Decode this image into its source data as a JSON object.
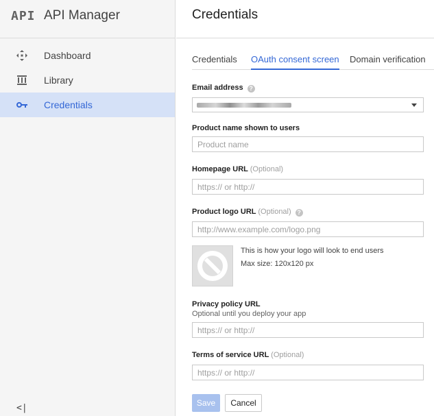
{
  "app": {
    "logo": "API",
    "title": "API Manager"
  },
  "sidebar": {
    "items": [
      {
        "label": "Dashboard",
        "icon": "dashboard-icon",
        "active": false
      },
      {
        "label": "Library",
        "icon": "library-icon",
        "active": false
      },
      {
        "label": "Credentials",
        "icon": "key-icon",
        "active": true
      }
    ],
    "collapse": "<|"
  },
  "header": {
    "title": "Credentials"
  },
  "tabs": [
    {
      "label": "Credentials",
      "active": false
    },
    {
      "label": "OAuth consent screen",
      "active": true
    },
    {
      "label": "Domain verification",
      "active": false
    }
  ],
  "form": {
    "email": {
      "label": "Email address",
      "value": "",
      "help_icon": "help-icon"
    },
    "product_name": {
      "label": "Product name shown to users",
      "placeholder": "Product name",
      "value": ""
    },
    "homepage": {
      "label": "Homepage URL",
      "optional": "(Optional)",
      "placeholder": "https:// or http://",
      "value": ""
    },
    "logo_url": {
      "label": "Product logo URL",
      "optional": "(Optional)",
      "placeholder": "http://www.example.com/logo.png",
      "value": "",
      "help_icon": "help-icon"
    },
    "logo_preview": {
      "line1": "This is how your logo will look to end users",
      "line2": "Max size: 120x120 px",
      "icon": "no-image-icon"
    },
    "privacy": {
      "label": "Privacy policy URL",
      "sublabel": "Optional until you deploy your app",
      "placeholder": "https:// or http://",
      "value": ""
    },
    "terms": {
      "label": "Terms of service URL",
      "optional": "(Optional)",
      "placeholder": "https:// or http://",
      "value": ""
    }
  },
  "buttons": {
    "save": "Save",
    "cancel": "Cancel"
  },
  "colors": {
    "accent": "#3367d6",
    "active_bg": "#d5e1f7",
    "save_disabled": "#a8c1ee"
  }
}
